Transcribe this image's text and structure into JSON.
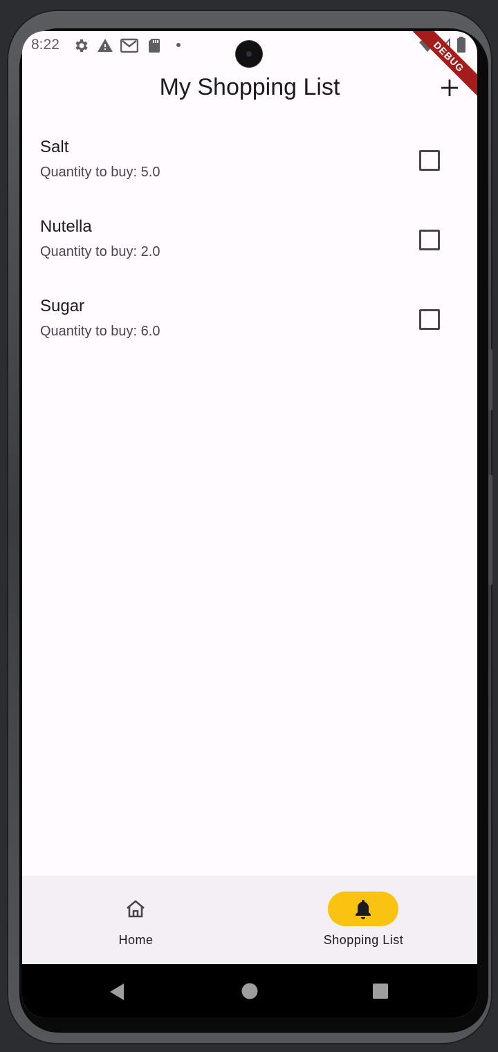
{
  "status_bar": {
    "time": "8:22",
    "left_icons": [
      "gear-icon",
      "warning-icon",
      "gmail-icon",
      "sd-card-icon",
      "dot-icon"
    ],
    "right_icons": [
      "wifi-icon",
      "signal-icon",
      "battery-icon"
    ]
  },
  "debug_banner": "DEBUG",
  "app_bar": {
    "title": "My Shopping List",
    "action_icon": "add-icon"
  },
  "items": [
    {
      "name": "Salt",
      "quantity": "Quantity to buy: 5.0",
      "checked": false
    },
    {
      "name": "Nutella",
      "quantity": "Quantity to buy: 2.0",
      "checked": false
    },
    {
      "name": "Sugar",
      "quantity": "Quantity to buy: 6.0",
      "checked": false
    }
  ],
  "bottom_nav": {
    "items": [
      {
        "label": "Home",
        "icon": "home-icon",
        "selected": false
      },
      {
        "label": "Shopping List",
        "icon": "bell-icon",
        "selected": true
      }
    ],
    "selected_color": "#fbc311"
  },
  "system_nav": [
    "back-icon",
    "home-circle-icon",
    "recents-icon"
  ],
  "colors": {
    "background": "#fffbfe",
    "nav_background": "#f3eff4",
    "text_primary": "#1c1b1f",
    "text_secondary": "#49454f",
    "debug_ribbon": "#a51c1c"
  }
}
